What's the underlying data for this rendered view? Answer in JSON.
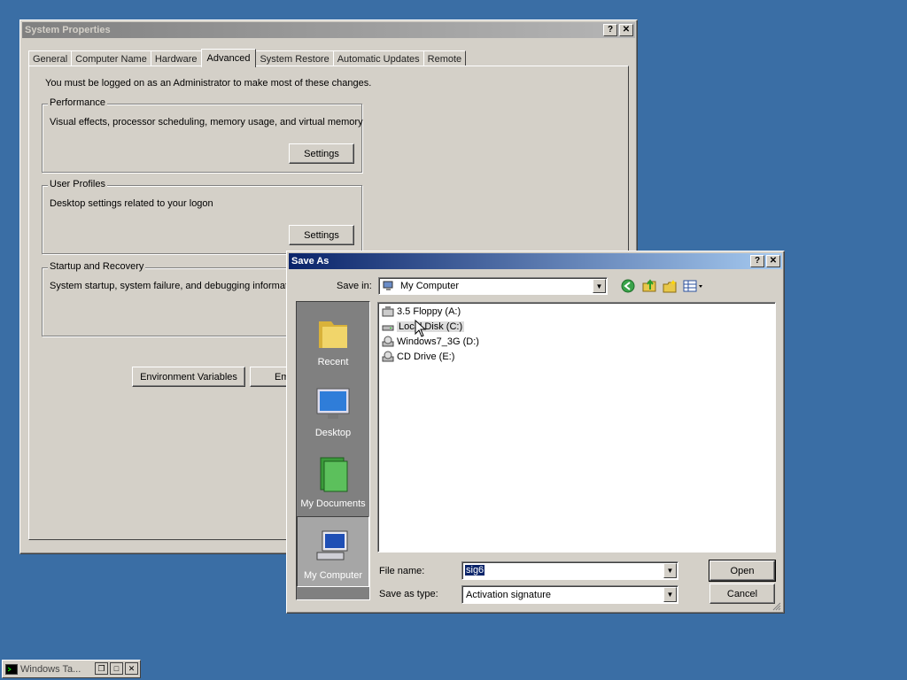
{
  "system_properties": {
    "title": "System Properties",
    "help_btn": "?",
    "close_btn": "✕",
    "tabs": [
      "General",
      "Computer Name",
      "Hardware",
      "Advanced",
      "System Restore",
      "Automatic Updates",
      "Remote"
    ],
    "selected_tab": "Advanced",
    "admin_note": "You must be logged on as an Administrator to make most of these changes.",
    "performance": {
      "label": "Performance",
      "desc": "Visual effects, processor scheduling, memory usage, and virtual memory",
      "button": "Settings"
    },
    "user_profiles": {
      "label": "User Profiles",
      "desc": "Desktop settings related to your logon",
      "button": "Settings"
    },
    "startup_recovery": {
      "label": "Startup and Recovery",
      "desc": "System startup, system failure, and debugging information"
    },
    "env_vars_button": "Environment Variables",
    "error_reporting_button_partial": "Em"
  },
  "save_as": {
    "title": "Save As",
    "help_btn": "?",
    "close_btn": "✕",
    "save_in_label": "Save in:",
    "save_in_value": "My Computer",
    "places": [
      {
        "label": "Recent",
        "icon": "folder-icon"
      },
      {
        "label": "Desktop",
        "icon": "desktop-icon"
      },
      {
        "label": "My Documents",
        "icon": "documents-icon"
      },
      {
        "label": "My Computer",
        "icon": "computer-icon"
      }
    ],
    "selected_place": "My Computer",
    "files": [
      {
        "name": "3.5 Floppy (A:)",
        "icon": "floppy-icon"
      },
      {
        "name": "Local Disk (C:)",
        "icon": "harddisk-icon",
        "selected": true
      },
      {
        "name": "Windows7_3G (D:)",
        "icon": "cd-icon"
      },
      {
        "name": "CD Drive (E:)",
        "icon": "cd-icon"
      }
    ],
    "file_name_label": "File name:",
    "file_name_value": "sig6",
    "save_as_type_label": "Save as type:",
    "save_as_type_value": "Activation signature",
    "open_button": "Open",
    "cancel_button": "Cancel"
  },
  "taskbar": {
    "item_label": "Windows Ta..."
  },
  "colors": {
    "desktop": "#3a6ea5",
    "dialog_face": "#d4d0c8",
    "active_title": "#0a246a",
    "inactive_title": "#808080",
    "selection": "#0a246a"
  }
}
